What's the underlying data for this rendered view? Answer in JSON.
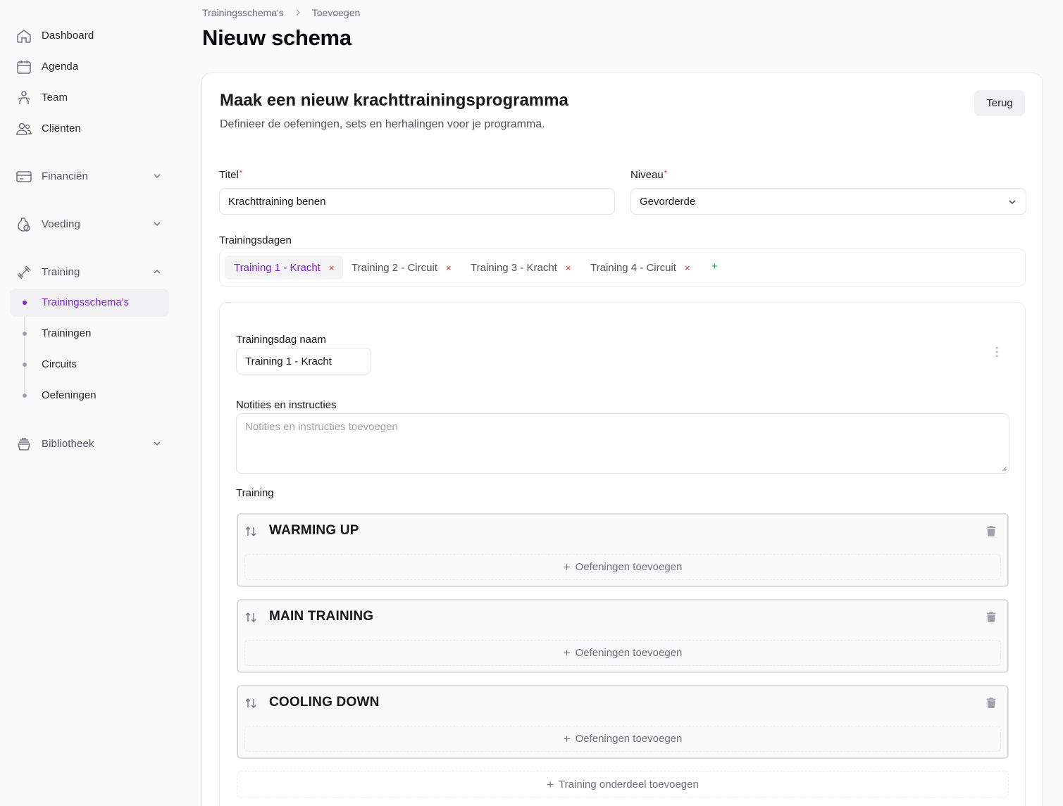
{
  "sidebar": {
    "items": [
      {
        "label": "Dashboard",
        "icon": "home-icon"
      },
      {
        "label": "Agenda",
        "icon": "calendar-icon"
      },
      {
        "label": "Team",
        "icon": "team-icon"
      },
      {
        "label": "Cliënten",
        "icon": "users-icon"
      },
      {
        "label": "Financiën",
        "icon": "credit-card-icon"
      },
      {
        "label": "Voeding",
        "icon": "nutrition-icon"
      },
      {
        "label": "Training",
        "icon": "dumbbell-icon"
      },
      {
        "label": "Bibliotheek",
        "icon": "bowl-icon"
      }
    ],
    "training_sub": [
      {
        "label": "Trainingsschema's",
        "active": true
      },
      {
        "label": "Trainingen",
        "active": false
      },
      {
        "label": "Circuits",
        "active": false
      },
      {
        "label": "Oefeningen",
        "active": false
      }
    ]
  },
  "breadcrumb": {
    "parent": "Trainingsschema's",
    "current": "Toevoegen"
  },
  "page_title": "Nieuw schema",
  "card": {
    "title": "Maak een nieuw krachttrainingsprogramma",
    "description": "Definieer de oefeningen, sets en herhalingen voor je programma.",
    "back_button": "Terug"
  },
  "form": {
    "title_label": "Titel",
    "title_value": "Krachttraining benen",
    "level_label": "Niveau",
    "level_value": "Gevorderde",
    "required_marker": "*",
    "days_label": "Trainingsdagen",
    "days": [
      {
        "label": "Training 1 - Kracht",
        "active": true
      },
      {
        "label": "Training 2 - Circuit",
        "active": false
      },
      {
        "label": "Training 3 - Kracht",
        "active": false
      },
      {
        "label": "Training 4 - Circuit",
        "active": false
      }
    ],
    "remove_glyph": "×",
    "add_glyph": "+"
  },
  "day": {
    "name_label": "Trainingsdag naam",
    "name_value": "Training 1 - Kracht",
    "notes_label": "Notities en instructies",
    "notes_placeholder": "Notities en instructies toevoegen",
    "training_label": "Training",
    "sections": [
      {
        "title": "WARMING UP",
        "add_label": "Oefeningen toevoegen"
      },
      {
        "title": "MAIN TRAINING",
        "add_label": "Oefeningen toevoegen"
      },
      {
        "title": "COOLING DOWN",
        "add_label": "Oefeningen toevoegen"
      }
    ],
    "add_part_label": "Training onderdeel toevoegen"
  },
  "colors": {
    "accent": "#7e22ce",
    "danger": "#dc2626",
    "success": "#16a34a"
  }
}
